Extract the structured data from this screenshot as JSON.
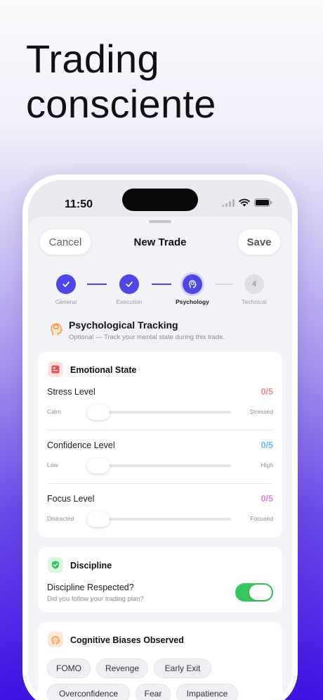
{
  "headline": [
    "Trading",
    "consciente"
  ],
  "status_bar": {
    "time": "11:50"
  },
  "nav": {
    "cancel_label": "Cancel",
    "title": "New Trade",
    "save_label": "Save"
  },
  "steps": [
    {
      "label": "General",
      "state": "done"
    },
    {
      "label": "Execution",
      "state": "done"
    },
    {
      "label": "Psychology",
      "state": "current"
    },
    {
      "label": "Technical",
      "state": "todo",
      "number": "4"
    }
  ],
  "section": {
    "title": "Psychological Tracking",
    "subtitle": "Optional — Track your mental state during this trade."
  },
  "emotional_state": {
    "title": "Emotional State",
    "sliders": [
      {
        "name": "Stress Level",
        "value": "0/5",
        "level": 0,
        "min_label": "Calm",
        "max_label": "Stressed",
        "color": "#f08c8c"
      },
      {
        "name": "Confidence Level",
        "value": "0/5",
        "level": 0,
        "min_label": "Low",
        "max_label": "High",
        "color": "#6fb7ec"
      },
      {
        "name": "Focus Level",
        "value": "0/5",
        "level": 0,
        "min_label": "Distracted",
        "max_label": "Focused",
        "color": "#d48ad8"
      }
    ]
  },
  "discipline": {
    "title": "Discipline",
    "question": "Discipline Respected?",
    "hint": "Did you follow your trading plan?",
    "toggle_on": true
  },
  "biases": {
    "title": "Cognitive Biases Observed",
    "chips": [
      "FOMO",
      "Revenge",
      "Early Exit",
      "Overconfidence",
      "Fear",
      "Impatience"
    ]
  },
  "colors": {
    "accent": "#4f46e5",
    "toggle_on": "#34c759"
  }
}
